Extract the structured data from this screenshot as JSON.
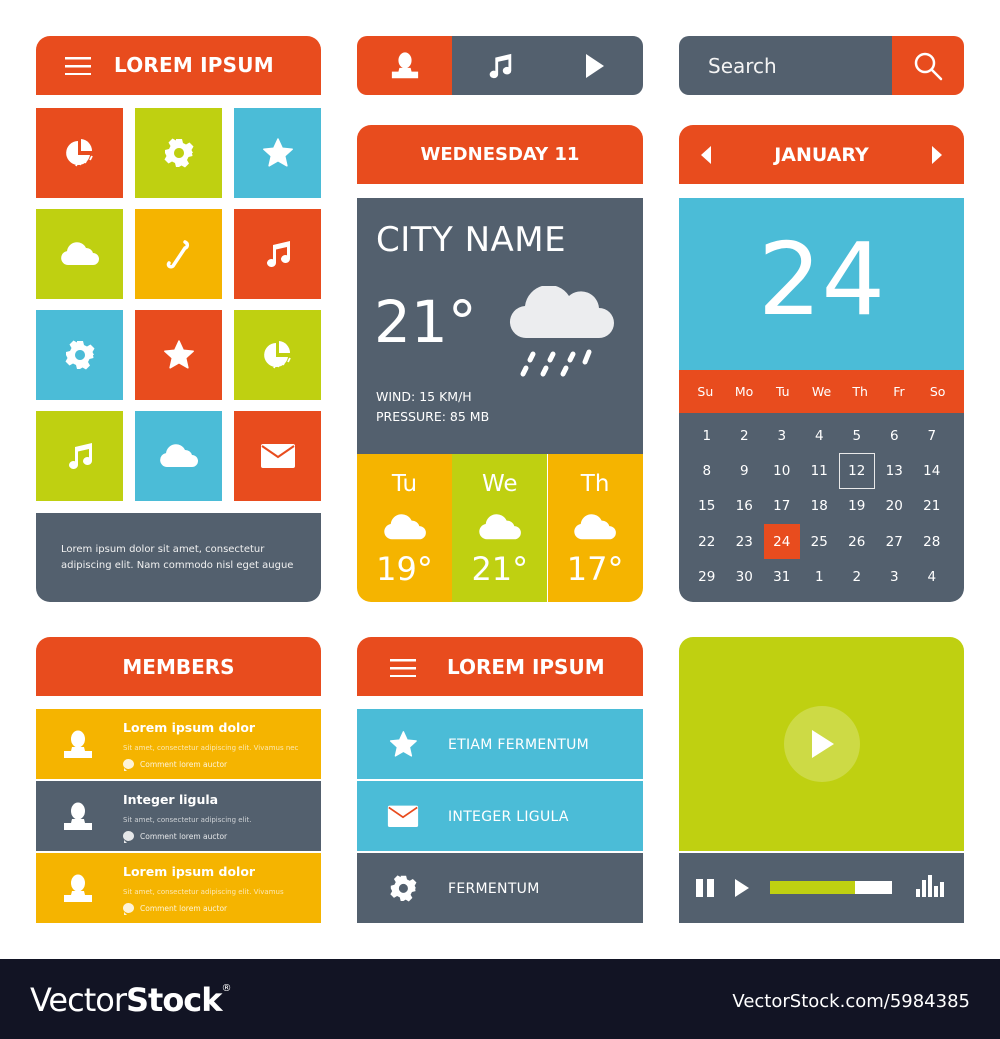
{
  "colors": {
    "orange": "#e84c1e",
    "lime": "#bfd011",
    "blue": "#4bbcd7",
    "yellow": "#f5b400",
    "slate": "#53606e",
    "footer": "#121424"
  },
  "tile_menu": {
    "title": "LOREM IPSUM",
    "menu_icon": "hamburger-icon",
    "tiles": [
      {
        "icon": "pie-chart-icon",
        "color": "orange"
      },
      {
        "icon": "gear-icon",
        "color": "lime"
      },
      {
        "icon": "star-icon",
        "color": "blue"
      },
      {
        "icon": "cloud-icon",
        "color": "lime"
      },
      {
        "icon": "phone-icon",
        "color": "yellow"
      },
      {
        "icon": "music-note-icon",
        "color": "orange"
      },
      {
        "icon": "gear-icon",
        "color": "blue"
      },
      {
        "icon": "star-icon",
        "color": "orange"
      },
      {
        "icon": "pie-chart-icon",
        "color": "lime"
      },
      {
        "icon": "music-note-icon",
        "color": "lime"
      },
      {
        "icon": "cloud-icon",
        "color": "blue"
      },
      {
        "icon": "mail-icon",
        "color": "orange"
      }
    ],
    "footer_text": "Lorem ipsum dolor sit amet, consectetur adipiscing elit. Nam commodo nisl eget augue"
  },
  "segmented_control": {
    "items": [
      {
        "icon": "user-icon",
        "active": true
      },
      {
        "icon": "music-note-icon",
        "active": false
      },
      {
        "icon": "play-icon",
        "active": false
      }
    ]
  },
  "search": {
    "placeholder": "Search",
    "button_icon": "search-icon"
  },
  "weather": {
    "header": "WEDNESDAY 11",
    "city": "CITY NAME",
    "temperature": "21°",
    "condition_icon": "rain-cloud-icon",
    "wind": "WIND: 15 KM/H",
    "pressure": "PRESSURE: 85 MB",
    "forecast": [
      {
        "day": "Tu",
        "icon": "cloud-icon",
        "temp": "19°",
        "color": "yellow"
      },
      {
        "day": "We",
        "icon": "cloud-icon",
        "temp": "21°",
        "color": "lime"
      },
      {
        "day": "Th",
        "icon": "cloud-icon",
        "temp": "17°",
        "color": "yellow"
      }
    ]
  },
  "calendar": {
    "month": "JANUARY",
    "selected_day": "24",
    "weekdays": [
      "Su",
      "Mo",
      "Tu",
      "We",
      "Th",
      "Fr",
      "So"
    ],
    "days": [
      "1",
      "2",
      "3",
      "4",
      "5",
      "6",
      "7",
      "8",
      "9",
      "10",
      "11",
      "12",
      "13",
      "14",
      "15",
      "16",
      "17",
      "18",
      "19",
      "20",
      "21",
      "22",
      "23",
      "24",
      "25",
      "26",
      "27",
      "28",
      "29",
      "30",
      "31",
      "1",
      "2",
      "3",
      "4"
    ],
    "outlined_day_index": 11,
    "selected_day_index": 23
  },
  "members": {
    "title": "MEMBERS",
    "items": [
      {
        "name": "Lorem ipsum dolor",
        "desc": "Sit amet, consectetur adipiscing elit. Vivamus nec",
        "comment": "Comment lorem auctor",
        "color": "yellow"
      },
      {
        "name": "Integer ligula",
        "desc": "Sit amet, consectetur adipiscing elit.",
        "comment": "Comment lorem auctor",
        "color": "slate"
      },
      {
        "name": "Lorem ipsum dolor",
        "desc": "Sit amet, consectetur adipiscing elit. Vivamus",
        "comment": "Comment lorem auctor",
        "color": "yellow"
      }
    ]
  },
  "nav_menu": {
    "title": "LOREM IPSUM",
    "items": [
      {
        "label": "ETIAM FERMENTUM",
        "icon": "star-icon",
        "color": "blue"
      },
      {
        "label": "INTEGER LIGULA",
        "icon": "mail-icon",
        "color": "blue"
      },
      {
        "label": "FERMENTUM",
        "icon": "gear-icon",
        "color": "slate"
      }
    ]
  },
  "video_player": {
    "progress_percent": 70
  },
  "footer": {
    "brand_light": "Vector",
    "brand_bold": "Stock",
    "brand_mark": "®",
    "reference": "VectorStock.com/5984385"
  }
}
